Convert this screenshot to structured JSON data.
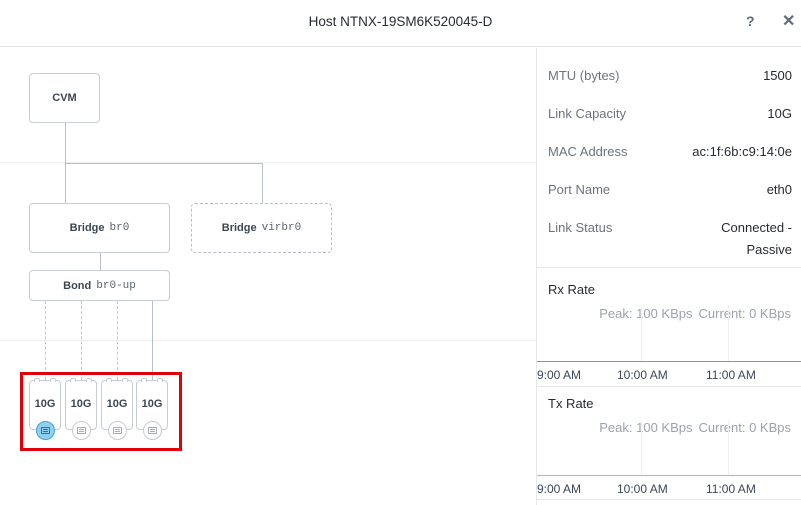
{
  "header": {
    "title": "Host NTNX-19SM6K520045-D",
    "help_glyph": "?",
    "close_glyph": "✕"
  },
  "topology": {
    "cvm_label": "CVM",
    "bridge_main": {
      "label": "Bridge",
      "name": "br0"
    },
    "bridge_virt": {
      "label": "Bridge",
      "name": "virbr0"
    },
    "bond": {
      "label": "Bond",
      "name": "br0-up"
    },
    "nics": [
      {
        "capacity": "10G",
        "active": true
      },
      {
        "capacity": "10G",
        "active": false
      },
      {
        "capacity": "10G",
        "active": false
      },
      {
        "capacity": "10G",
        "active": false
      }
    ]
  },
  "details": {
    "mtu": {
      "label": "MTU (bytes)",
      "value": "1500"
    },
    "link_capacity": {
      "label": "Link Capacity",
      "value": "10G"
    },
    "mac": {
      "label": "MAC Address",
      "value": "ac:1f:6b:c9:14:0e"
    },
    "port_name": {
      "label": "Port Name",
      "value": "eth0"
    },
    "link_status": {
      "label": "Link Status",
      "value_line1": "Connected -",
      "value_line2": "Passive"
    }
  },
  "charts": {
    "rx": {
      "title": "Rx Rate",
      "peak": "Peak: 100 KBps",
      "current": "Current: 0 KBps",
      "line_color": "#5cb85c",
      "ticks": [
        "9:00 AM",
        "10:00 AM",
        "11:00 AM"
      ]
    },
    "tx": {
      "title": "Tx Rate",
      "peak": "Peak: 100 KBps",
      "current": "Current: 0 KBps",
      "line_color": "#f0ad4e",
      "ticks": [
        "9:00 AM",
        "10:00 AM",
        "11:00 AM"
      ]
    }
  }
}
